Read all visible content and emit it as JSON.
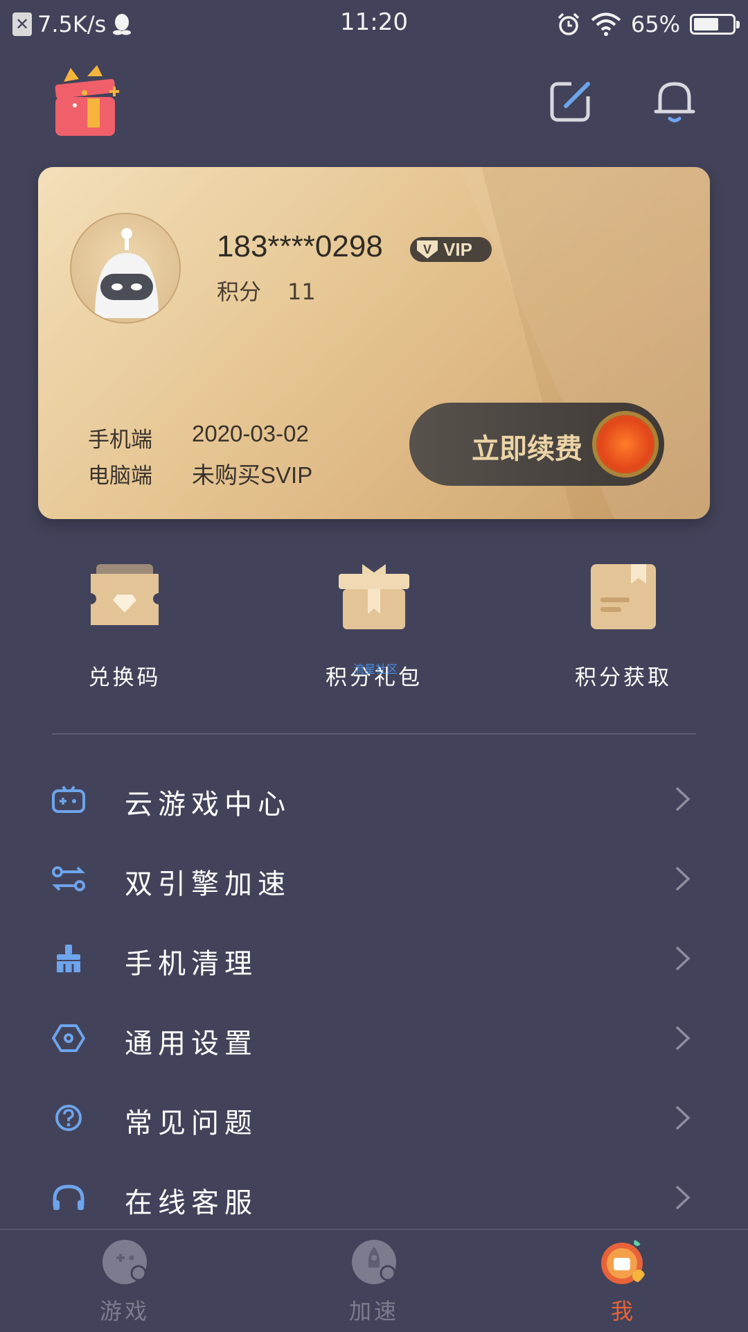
{
  "status_bar": {
    "net_speed": "7.5K/s",
    "time": "11:20",
    "battery_percent": "65%",
    "battery_level": 0.65
  },
  "header": {
    "logo_icon": "gift-box-icon",
    "edit_icon": "edit-square-icon",
    "bell_icon": "bell-icon"
  },
  "vip_card": {
    "phone": "183****0298",
    "badge": "VIP",
    "badge_v": "V",
    "points_label": "积分",
    "points_value": "11",
    "mobile_label": "手机端",
    "mobile_value": "2020-03-02",
    "pc_label": "电脑端",
    "pc_value": "未购买SVIP",
    "renew_label": "立即续费"
  },
  "quick_actions": [
    {
      "label": "兑换码",
      "icon": "ticket-icon"
    },
    {
      "label": "积分礼包",
      "icon": "gift-icon"
    },
    {
      "label": "积分获取",
      "icon": "bookmark-box-icon"
    }
  ],
  "watermark": "流星社区",
  "menu": [
    {
      "label": "云游戏中心",
      "icon": "gamepad-icon"
    },
    {
      "label": "双引擎加速",
      "icon": "dual-engine-icon"
    },
    {
      "label": "手机清理",
      "icon": "broom-icon"
    },
    {
      "label": "通用设置",
      "icon": "hexagon-settings-icon"
    },
    {
      "label": "常见问题",
      "icon": "question-icon"
    },
    {
      "label": "在线客服",
      "icon": "headset-icon"
    }
  ],
  "bottom_nav": [
    {
      "label": "游戏",
      "active": false
    },
    {
      "label": "加速",
      "active": false
    },
    {
      "label": "我",
      "active": true
    }
  ],
  "colors": {
    "background": "#42435a",
    "accent_blue": "#6ea4ec",
    "active_tab": "#e8633a",
    "inactive_tab": "#7b7c8e"
  }
}
